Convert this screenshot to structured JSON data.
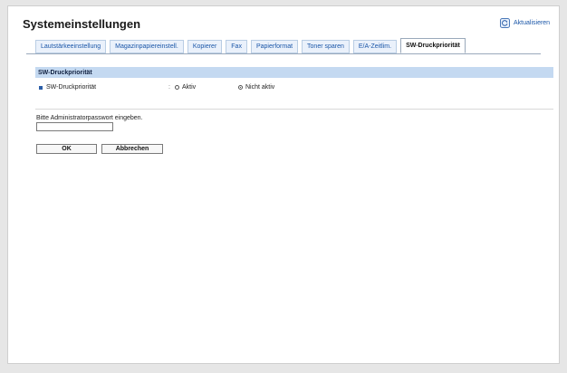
{
  "header": {
    "title": "Systemeinstellungen",
    "refresh_label": "Aktualisieren",
    "refresh_icon": "refresh-icon"
  },
  "tabs": [
    {
      "label": "Lautstärkeeinstellung",
      "active": false
    },
    {
      "label": "Magazinpapiereinstell.",
      "active": false
    },
    {
      "label": "Kopierer",
      "active": false
    },
    {
      "label": "Fax",
      "active": false
    },
    {
      "label": "Papierformat",
      "active": false
    },
    {
      "label": "Toner sparen",
      "active": false
    },
    {
      "label": "E/A-Zeitlim.",
      "active": false
    },
    {
      "label": "SW-Druckpriorität",
      "active": true
    }
  ],
  "section": {
    "header": "SW-Druckpriorität",
    "setting": {
      "label": "SW-Druckpriorität",
      "separator": ":",
      "options": [
        {
          "label": "Aktiv",
          "selected": false
        },
        {
          "label": "Nicht aktiv",
          "selected": true
        }
      ]
    }
  },
  "admin": {
    "prompt": "Bitte Administratorpasswort eingeben.",
    "password_value": ""
  },
  "buttons": {
    "ok_label": "OK",
    "cancel_label": "Abbrechen"
  },
  "colors": {
    "section_header_bg": "#c4d9f1",
    "tab_bg": "#eaf1fb",
    "link": "#1a56a8"
  }
}
